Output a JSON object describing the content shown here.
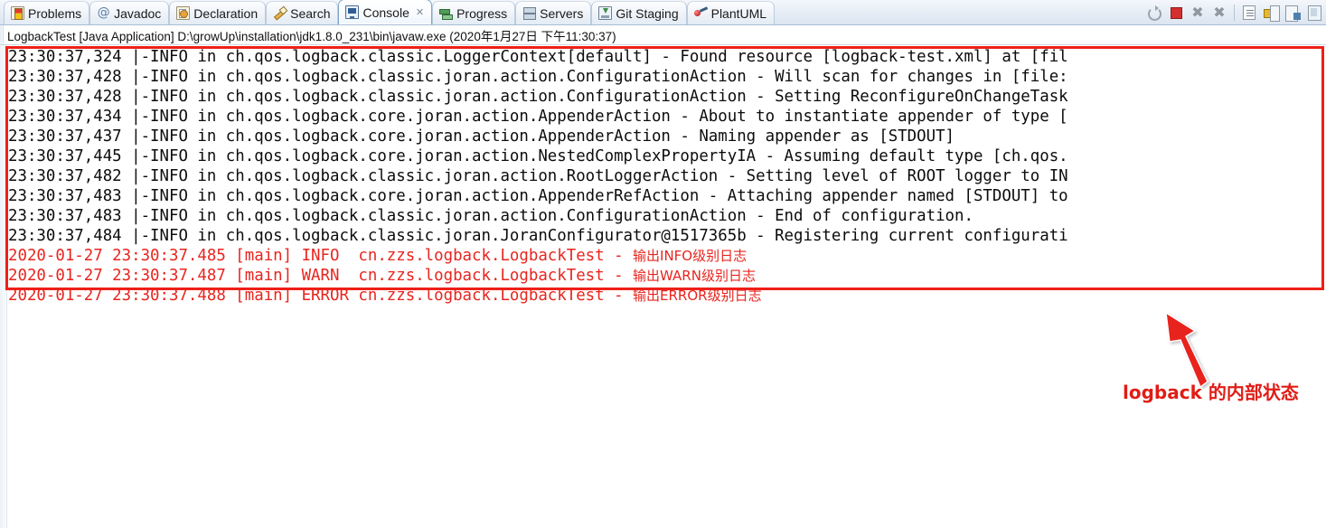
{
  "window": {
    "launch_title": "LogbackTest [Java Application] D:\\growUp\\installation\\jdk1.8.0_231\\bin\\javaw.exe (2020年1月27日 下午11:30:37)"
  },
  "tabs": [
    {
      "label": "Problems",
      "icon": "problems-icon",
      "active": false,
      "closable": false
    },
    {
      "label": "Javadoc",
      "icon": "javadoc-icon",
      "active": false,
      "closable": false
    },
    {
      "label": "Declaration",
      "icon": "declaration-icon",
      "active": false,
      "closable": false
    },
    {
      "label": "Search",
      "icon": "search-icon",
      "active": false,
      "closable": false
    },
    {
      "label": "Console",
      "icon": "console-icon",
      "active": true,
      "closable": true,
      "close_glyph": "✕"
    },
    {
      "label": "Progress",
      "icon": "progress-icon",
      "active": false,
      "closable": false
    },
    {
      "label": "Servers",
      "icon": "servers-icon",
      "active": false,
      "closable": false
    },
    {
      "label": "Git Staging",
      "icon": "git-staging-icon",
      "active": false,
      "closable": false
    },
    {
      "label": "PlantUML",
      "icon": "plantuml-icon",
      "active": false,
      "closable": false
    }
  ],
  "toolbar": {
    "buttons": [
      {
        "name": "relaunch-button",
        "tooltip": "Relaunch"
      },
      {
        "name": "terminate-button",
        "tooltip": "Terminate"
      },
      {
        "name": "remove-launch-button",
        "tooltip": "Remove Launch",
        "glyph": "✖"
      },
      {
        "name": "remove-all-launches-button",
        "tooltip": "Remove All Terminated Launches",
        "glyph": "✖"
      },
      {
        "name": "clear-console-button",
        "tooltip": "Clear Console"
      },
      {
        "name": "scroll-lock-button",
        "tooltip": "Scroll Lock"
      },
      {
        "name": "word-wrap-button",
        "tooltip": "Word Wrap"
      },
      {
        "name": "pin-console-button",
        "tooltip": "Pin Console"
      }
    ]
  },
  "console": {
    "internal_status_lines": [
      "23:30:37,324 |-INFO in ch.qos.logback.classic.LoggerContext[default] - Found resource [logback-test.xml] at [fil",
      "23:30:37,428 |-INFO in ch.qos.logback.classic.joran.action.ConfigurationAction - Will scan for changes in [file:",
      "23:30:37,428 |-INFO in ch.qos.logback.classic.joran.action.ConfigurationAction - Setting ReconfigureOnChangeTask",
      "23:30:37,434 |-INFO in ch.qos.logback.core.joran.action.AppenderAction - About to instantiate appender of type [",
      "23:30:37,437 |-INFO in ch.qos.logback.core.joran.action.AppenderAction - Naming appender as [STDOUT]",
      "23:30:37,445 |-INFO in ch.qos.logback.core.joran.action.NestedComplexPropertyIA - Assuming default type [ch.qos.",
      "23:30:37,482 |-INFO in ch.qos.logback.classic.joran.action.RootLoggerAction - Setting level of ROOT logger to IN",
      "23:30:37,483 |-INFO in ch.qos.logback.core.joran.action.AppenderRefAction - Attaching appender named [STDOUT] to",
      "23:30:37,483 |-INFO in ch.qos.logback.classic.joran.action.ConfigurationAction - End of configuration.",
      "23:30:37,484 |-INFO in ch.qos.logback.classic.joran.JoranConfigurator@1517365b - Registering current configurati"
    ],
    "application_lines": [
      {
        "prefix": "2020-01-27 23:30:37.485 [main] INFO  cn.zzs.logback.LogbackTest - ",
        "message": "输出INFO级别日志"
      },
      {
        "prefix": "2020-01-27 23:30:37.487 [main] WARN  cn.zzs.logback.LogbackTest - ",
        "message": "输出WARN级别日志"
      },
      {
        "prefix": "2020-01-27 23:30:37.488 [main] ERROR cn.zzs.logback.LogbackTest - ",
        "message": "输出ERROR级别日志"
      }
    ]
  },
  "annotation": {
    "label_en": "logback",
    "label_cn": " 的内部状态",
    "arrow": "up-left-arrow-icon",
    "color": "#e01d16"
  },
  "colors": {
    "highlight_box": "#ee2017",
    "app_log_text": "#e8251f",
    "info_log_text": "#0c0c0c",
    "annotation": "#e01d16"
  }
}
